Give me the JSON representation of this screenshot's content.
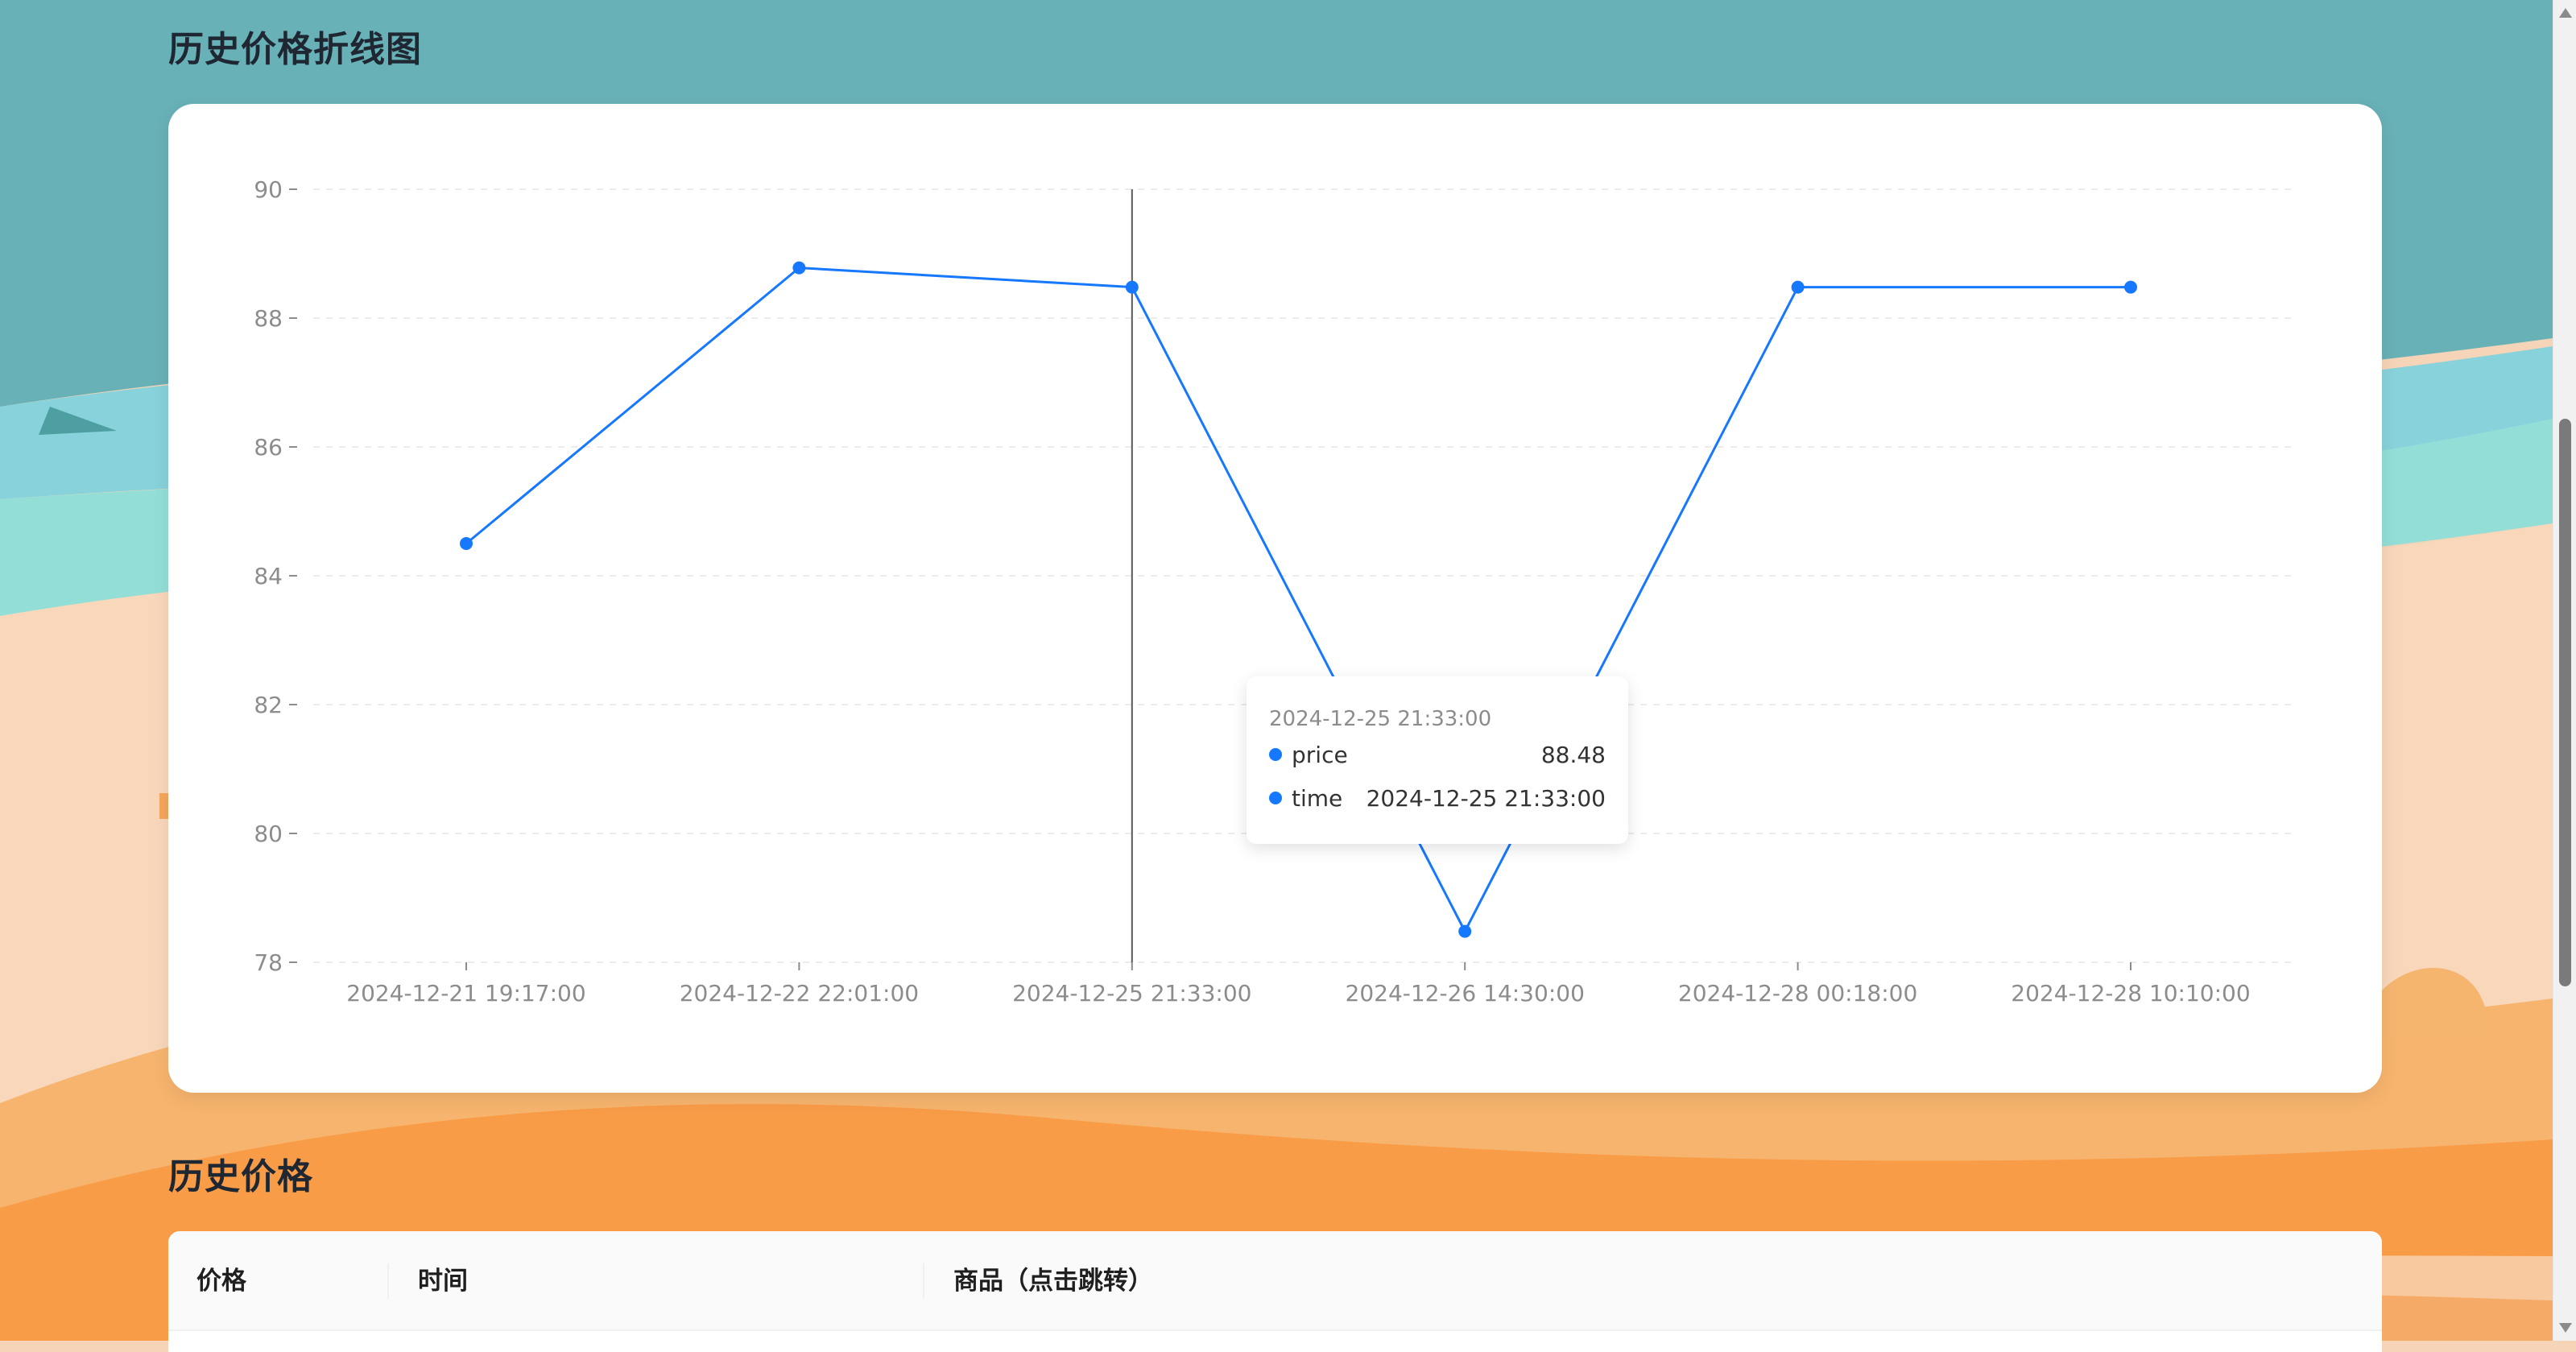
{
  "sections": {
    "chart_title": "历史价格折线图",
    "table_title": "历史价格"
  },
  "chart_data": {
    "type": "line",
    "categories": [
      "2024-12-21 19:17:00",
      "2024-12-22 22:01:00",
      "2024-12-25 21:33:00",
      "2024-12-26 14:30:00",
      "2024-12-28 00:18:00",
      "2024-12-28 10:10:00"
    ],
    "values": [
      84.5,
      88.78,
      88.48,
      78.48,
      88.48,
      88.48
    ],
    "ylim": [
      78,
      90
    ],
    "yticks": [
      90,
      88,
      86,
      84,
      82,
      80,
      78
    ],
    "grid": true,
    "line_color": "#1677ff"
  },
  "tooltip": {
    "title": "2024-12-25 21:33:00",
    "rows": [
      {
        "key": "price",
        "value": "88.48"
      },
      {
        "key": "time",
        "value": "2024-12-25 21:33:00"
      }
    ]
  },
  "table": {
    "columns": [
      "价格",
      "时间",
      "商品（点击跳转）"
    ]
  }
}
